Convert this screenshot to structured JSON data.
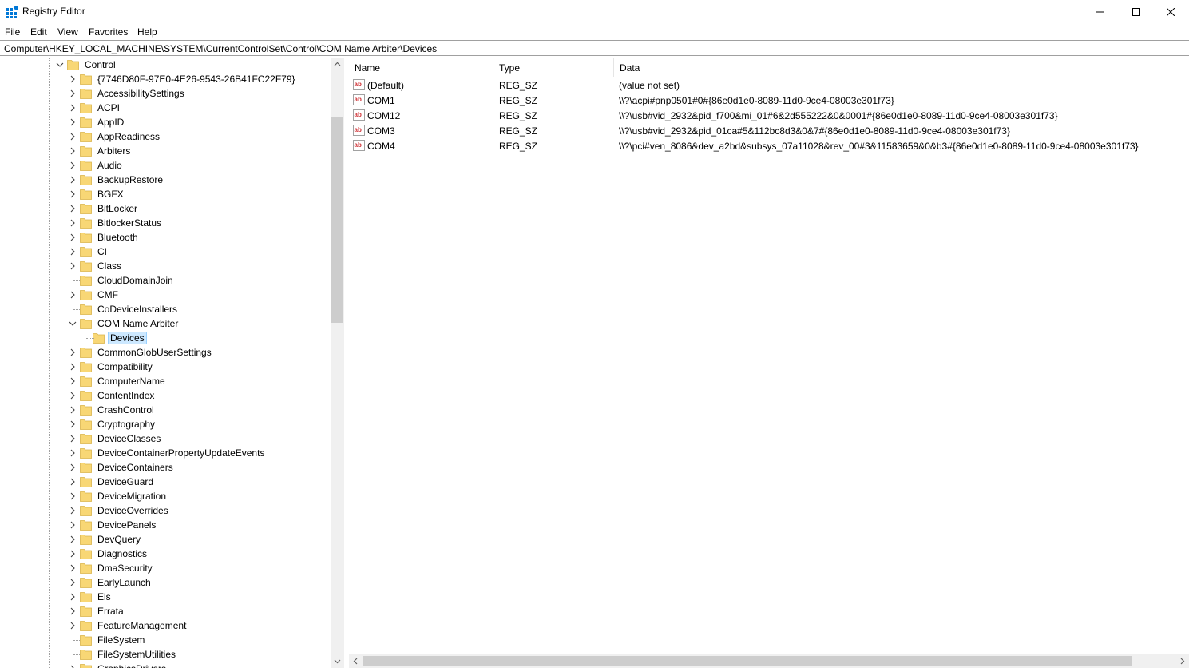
{
  "window": {
    "title": "Registry Editor",
    "accent": "#0078d7"
  },
  "menu": [
    "File",
    "Edit",
    "View",
    "Favorites",
    "Help"
  ],
  "address": "Computer\\HKEY_LOCAL_MACHINE\\SYSTEM\\CurrentControlSet\\Control\\COM Name Arbiter\\Devices",
  "tree": {
    "root": "Control",
    "children": [
      "{7746D80F-97E0-4E26-9543-26B41FC22F79}",
      "AccessibilitySettings",
      "ACPI",
      "AppID",
      "AppReadiness",
      "Arbiters",
      "Audio",
      "BackupRestore",
      "BGFX",
      "BitLocker",
      "BitlockerStatus",
      "Bluetooth",
      "CI",
      "Class",
      "CloudDomainJoin",
      "CMF",
      "CoDeviceInstallers",
      "COM Name Arbiter",
      "Devices",
      "CommonGlobUserSettings",
      "Compatibility",
      "ComputerName",
      "ContentIndex",
      "CrashControl",
      "Cryptography",
      "DeviceClasses",
      "DeviceContainerPropertyUpdateEvents",
      "DeviceContainers",
      "DeviceGuard",
      "DeviceMigration",
      "DeviceOverrides",
      "DevicePanels",
      "DevQuery",
      "Diagnostics",
      "DmaSecurity",
      "EarlyLaunch",
      "Els",
      "Errata",
      "FeatureManagement",
      "FileSystem",
      "FileSystemUtilities",
      "GraphicsDrivers"
    ],
    "selected": "Devices"
  },
  "list": {
    "headers": [
      "Name",
      "Type",
      "Data"
    ],
    "rows": [
      {
        "name": "(Default)",
        "type": "REG_SZ",
        "data": "(value not set)"
      },
      {
        "name": "COM1",
        "type": "REG_SZ",
        "data": "\\\\?\\acpi#pnp0501#0#{86e0d1e0-8089-11d0-9ce4-08003e301f73}"
      },
      {
        "name": "COM12",
        "type": "REG_SZ",
        "data": "\\\\?\\usb#vid_2932&pid_f700&mi_01#6&2d555222&0&0001#{86e0d1e0-8089-11d0-9ce4-08003e301f73}"
      },
      {
        "name": "COM3",
        "type": "REG_SZ",
        "data": "\\\\?\\usb#vid_2932&pid_01ca#5&112bc8d3&0&7#{86e0d1e0-8089-11d0-9ce4-08003e301f73}"
      },
      {
        "name": "COM4",
        "type": "REG_SZ",
        "data": "\\\\?\\pci#ven_8086&dev_a2bd&subsys_07a11028&rev_00#3&11583659&0&b3#{86e0d1e0-8089-11d0-9ce4-08003e301f73}"
      }
    ]
  },
  "colors": {
    "folder": "#f8d775",
    "selection": "#cce8ff",
    "string_icon": "#d13438"
  }
}
